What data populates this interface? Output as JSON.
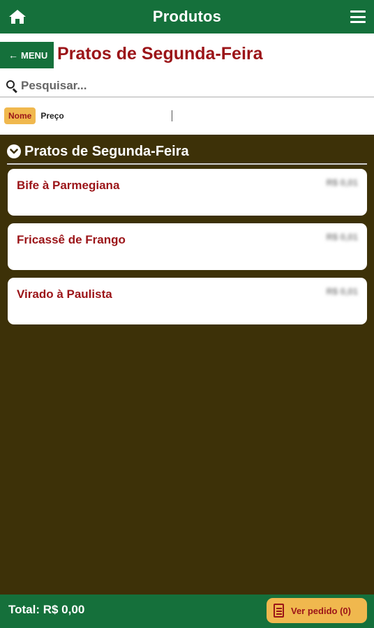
{
  "header": {
    "title": "Produtos",
    "home_icon": "home-icon",
    "menu_icon": "hamburger-icon"
  },
  "subheader": {
    "menu_label": "MENU",
    "page_title": "Pratos de Segunda-Feira"
  },
  "search": {
    "placeholder": "Pesquisar..."
  },
  "sort": {
    "name_label": "Nome",
    "price_label": "Preço",
    "active": "Nome"
  },
  "section": {
    "title": "Pratos de Segunda-Feira"
  },
  "products": [
    {
      "name": "Bife à Parmegiana",
      "price": "R$ 0,01"
    },
    {
      "name": "Fricassê de Frango",
      "price": "R$ 0,01"
    },
    {
      "name": "Virado à Paulista",
      "price": "R$ 0,01"
    }
  ],
  "footer": {
    "total_label": "Total: R$ 0,00",
    "order_label": "Ver pedido (0)"
  },
  "colors": {
    "brand_green": "#15703b",
    "accent_red": "#9b1418",
    "background_brown": "#3d3108",
    "highlight_yellow": "#f0b84e"
  }
}
